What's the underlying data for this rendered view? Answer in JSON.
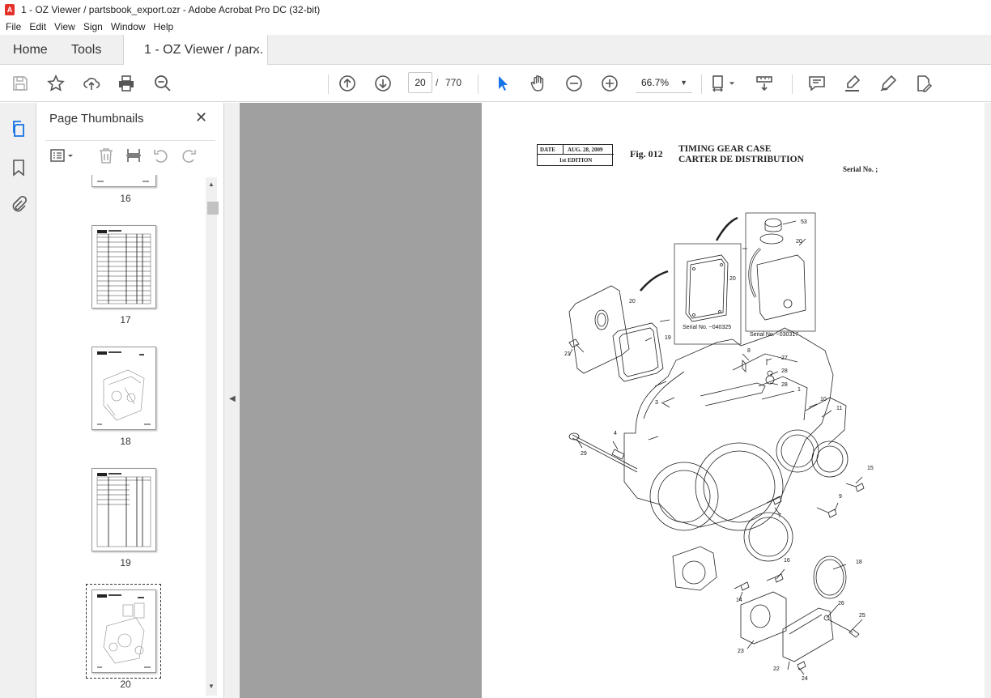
{
  "window": {
    "title": "1 - OZ Viewer / partsbook_export.ozr - Adobe Acrobat Pro DC (32-bit)"
  },
  "menu": [
    "File",
    "Edit",
    "View",
    "Sign",
    "Window",
    "Help"
  ],
  "tabs": {
    "home": "Home",
    "tools": "Tools",
    "document": "1 - OZ Viewer / par...",
    "close": "✕"
  },
  "toolbar": {
    "current_page": "20",
    "page_separator": "/",
    "total_pages": "770",
    "zoom": "66.7%"
  },
  "thumbnails": {
    "title": "Page Thumbnails",
    "close": "✕",
    "pages": [
      {
        "label": "16"
      },
      {
        "label": "17"
      },
      {
        "label": "18"
      },
      {
        "label": "19"
      },
      {
        "label": "20"
      }
    ],
    "selected_page": "20"
  },
  "page": {
    "date_label": "DATE",
    "date_value": "AUG. 28, 2009",
    "edition": "1st EDITION",
    "fig": "Fig. 012",
    "title_en": "TIMING GEAR CASE",
    "title_fr": "CARTER DE DISTRIBUTION",
    "serial_label": "Serial No. ;",
    "inset_serial_1": "Serial No.  ~040325",
    "inset_serial_2": "Serial No.  ~030317",
    "callouts": [
      "53",
      "20",
      "20",
      "20",
      "19",
      "21",
      "8",
      "27",
      "28",
      "28",
      "1",
      "3",
      "10",
      "11",
      "4",
      "29",
      "15",
      "9",
      "7",
      "16",
      "18",
      "14",
      "26",
      "25",
      "23",
      "22",
      "24"
    ]
  },
  "colors": {
    "accent_blue": "#1473e6",
    "workspace_gray": "#a0a0a0",
    "acrobat_red": "#e4312b"
  }
}
